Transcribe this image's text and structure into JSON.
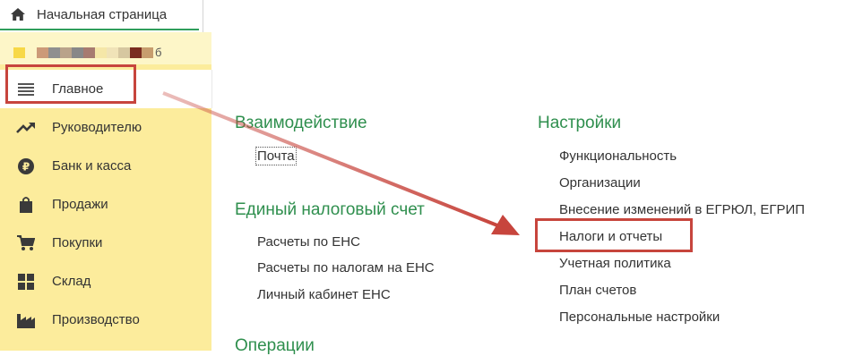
{
  "tabs": [
    {
      "label": "Начальная страница",
      "icon": "home-icon"
    }
  ],
  "sidebar": {
    "blurred_colors": [
      "#f7d847",
      "#fdf6c8",
      "#cc9a78",
      "#8f8f8f",
      "#b9a38a",
      "#888888",
      "#a77b70",
      "#f5e7a8",
      "#f0e3b8",
      "#d6c7a0",
      "#7a2c20",
      "#c79d6e"
    ],
    "blurred_tail": "б",
    "items": [
      {
        "label": "Главное",
        "icon": "menu-icon",
        "active": true
      },
      {
        "label": "Руководителю",
        "icon": "trend-up-icon"
      },
      {
        "label": "Банк и касса",
        "icon": "ruble-icon"
      },
      {
        "label": "Продажи",
        "icon": "shopping-bag-icon"
      },
      {
        "label": "Покупки",
        "icon": "cart-icon"
      },
      {
        "label": "Склад",
        "icon": "warehouse-grid-icon"
      },
      {
        "label": "Производство",
        "icon": "factory-icon"
      }
    ]
  },
  "content": {
    "sections": {
      "interaction": {
        "title": "Взаимодействие",
        "links": [
          "Почта"
        ]
      },
      "ens": {
        "title": "Единый налоговый счет",
        "links": [
          "Расчеты по ЕНС",
          "Расчеты по налогам на ЕНС",
          "Личный кабинет ЕНС"
        ]
      },
      "operations": {
        "title": "Операции"
      },
      "settings": {
        "title": "Настройки",
        "links": [
          "Функциональность",
          "Организации",
          "Внесение изменений в ЕГРЮЛ, ЕГРИП",
          "Налоги и отчеты",
          "Учетная политика",
          "План счетов",
          "Персональные настройки"
        ]
      }
    }
  },
  "annotations": {
    "highlight_color": "#c7453d"
  }
}
